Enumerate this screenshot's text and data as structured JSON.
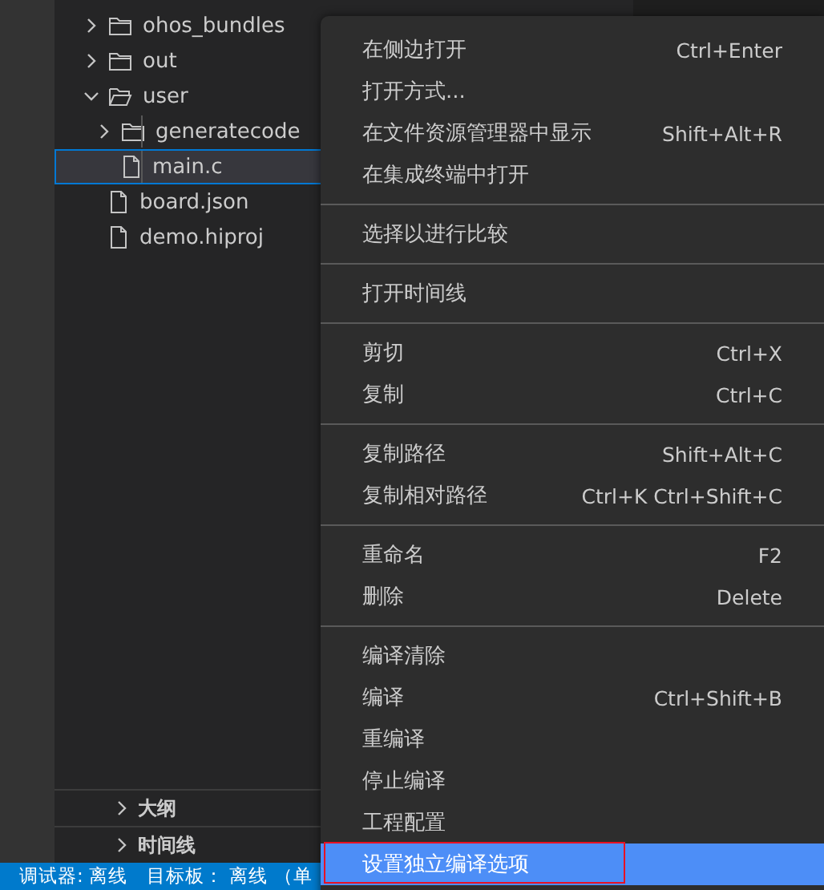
{
  "explorer": {
    "items": [
      {
        "kind": "folder",
        "label": "ohos_bundles",
        "expanded": false,
        "selected": false
      },
      {
        "kind": "folder",
        "label": "out",
        "expanded": false,
        "selected": false
      },
      {
        "kind": "folder",
        "label": "user",
        "expanded": true,
        "selected": false,
        "children": [
          {
            "kind": "folder",
            "label": "generatecode",
            "expanded": false,
            "selected": false
          },
          {
            "kind": "file",
            "label": "main.c",
            "selected": true
          }
        ]
      },
      {
        "kind": "file",
        "label": "board.json",
        "selected": false
      },
      {
        "kind": "file",
        "label": "demo.hiproj",
        "selected": false
      }
    ]
  },
  "panels": [
    {
      "label": "大纲",
      "expanded": false
    },
    {
      "label": "时间线",
      "expanded": false
    }
  ],
  "status_bar": [
    "调试器: 离线",
    "目标板： 离线 （单"
  ],
  "context_menu": {
    "groups": [
      [
        {
          "label": "在侧边打开",
          "shortcut": "Ctrl+Enter",
          "selected": false
        },
        {
          "label": "打开方式...",
          "selected": false
        },
        {
          "label": "在文件资源管理器中显示",
          "shortcut": "Shift+Alt+R",
          "selected": false
        },
        {
          "label": "在集成终端中打开",
          "selected": false
        }
      ],
      [
        {
          "label": "选择以进行比较",
          "selected": false
        }
      ],
      [
        {
          "label": "打开时间线",
          "selected": false
        }
      ],
      [
        {
          "label": "剪切",
          "shortcut": "Ctrl+X",
          "selected": false
        },
        {
          "label": "复制",
          "shortcut": "Ctrl+C",
          "selected": false
        }
      ],
      [
        {
          "label": "复制路径",
          "shortcut": "Shift+Alt+C",
          "selected": false
        },
        {
          "label": "复制相对路径",
          "shortcut": "Ctrl+K Ctrl+Shift+C",
          "selected": false
        }
      ],
      [
        {
          "label": "重命名",
          "shortcut": "F2",
          "selected": false
        },
        {
          "label": "删除",
          "shortcut": "Delete",
          "selected": false
        }
      ],
      [
        {
          "label": "编译清除",
          "selected": false
        },
        {
          "label": "编译",
          "shortcut": "Ctrl+Shift+B",
          "selected": false
        },
        {
          "label": "重编译",
          "selected": false
        },
        {
          "label": "停止编译",
          "selected": false
        },
        {
          "label": "工程配置",
          "selected": false
        },
        {
          "label": "设置独立编译选项",
          "selected": true,
          "marked": true
        }
      ]
    ]
  }
}
